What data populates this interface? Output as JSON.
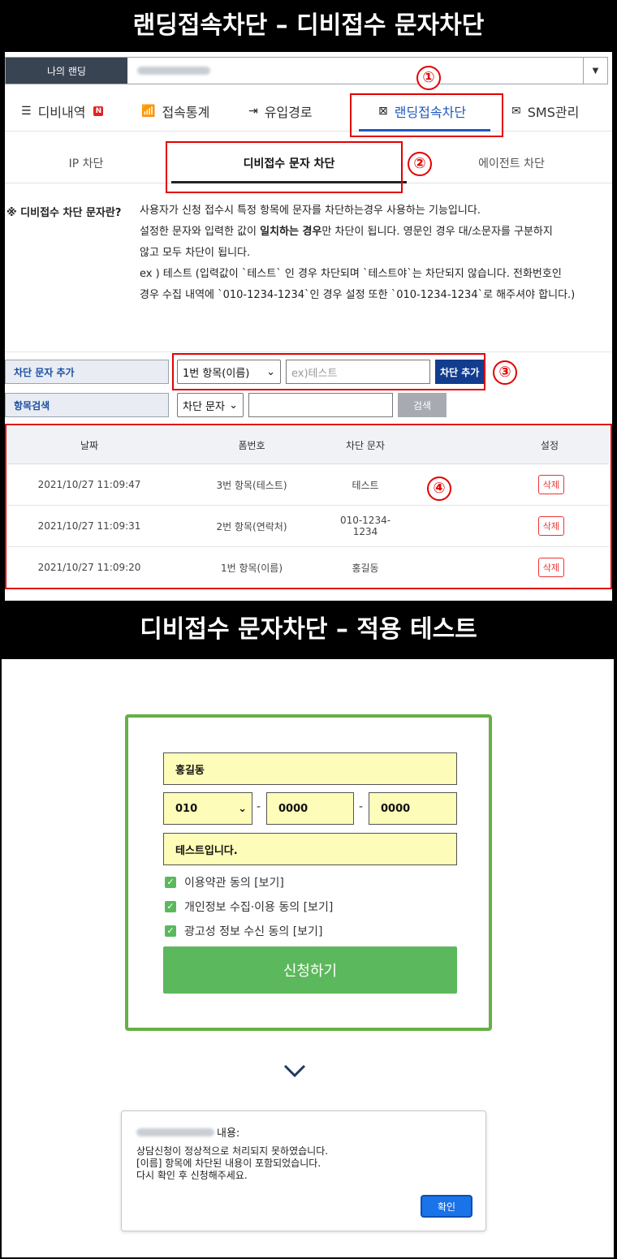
{
  "headers": {
    "top": "랜딩접속차단 – 디비접수 문자차단",
    "bottom": "디비접수 문자차단 – 적용 테스트"
  },
  "landing": {
    "label": "나의 랜딩"
  },
  "tabs": [
    {
      "label": "디비내역",
      "badge": "N"
    },
    {
      "label": "접속통계"
    },
    {
      "label": "유입경로"
    },
    {
      "label": "랜딩접속차단"
    },
    {
      "label": "SMS관리"
    }
  ],
  "subtabs": [
    {
      "label": "IP 차단"
    },
    {
      "label": "디비접수 문자 차단"
    },
    {
      "label": "에이전트 차단"
    }
  ],
  "description": {
    "title": "※ 디비접수 차단 문자란?",
    "line1": "사용자가 신청 접수시 특정 항목에 문자를 차단하는경우 사용하는 기능입니다.",
    "line2_pre": "설정한 문자와 입력한 값이 ",
    "line2_bold": "일치하는 경우",
    "line2_post": "만 차단이 됩니다. 영문인 경우 대/소문자를 구분하지",
    "line3": "않고 모두 차단이 됩니다.",
    "line4": "ex ) 테스트 (입력값이 `테스트` 인 경우 차단되며 `테스트야`는 차단되지 않습니다. 전화번호인",
    "line5": "경우 수집 내역에 `010-1234-1234`인 경우 설정 또한 `010-1234-1234`로 해주셔야 합니다.)"
  },
  "add_form": {
    "label": "차단 문자 추가",
    "select_value": "1번 항목(이름)",
    "placeholder": "ex)테스트",
    "button": "차단 추가"
  },
  "search_form": {
    "label": "항목검색",
    "select_value": "차단 문자",
    "button": "검색"
  },
  "table": {
    "headers": [
      "날짜",
      "폼번호",
      "차단 문자",
      "설정"
    ],
    "rows": [
      {
        "date": "2021/10/27 11:09:47",
        "form": "3번 항목(테스트)",
        "text": "테스트",
        "action": "삭제"
      },
      {
        "date": "2021/10/27 11:09:31",
        "form": "2번 항목(연락처)",
        "text": "010-1234-1234",
        "action": "삭제"
      },
      {
        "date": "2021/10/27 11:09:20",
        "form": "1번 항목(이름)",
        "text": "홍길동",
        "action": "삭제"
      }
    ]
  },
  "annotations": [
    "①",
    "②",
    "③",
    "④"
  ],
  "test_form": {
    "name": "홍길동",
    "phone1": "010",
    "phone2": "0000",
    "phone3": "0000",
    "dash": "-",
    "message": "테스트입니다.",
    "checks": [
      "이용약관 동의 [보기]",
      "개인정보 수집·이용 동의 [보기]",
      "광고성 정보 수신 동의 [보기]"
    ],
    "submit": "신청하기"
  },
  "alert": {
    "title_suffix": " 내용:",
    "line1": "상담신청이 정상적으로 처리되지 못하였습니다.",
    "line2": "[이름] 항목에 차단된 내용이 포함되었습니다.",
    "line3": "다시 확인 후 신청해주세요.",
    "ok": "확인"
  },
  "colors": {
    "accent_blue": "#1d57c0",
    "annotation_red": "#e30000",
    "form_green": "#5cb85c",
    "input_yellow": "#fdfcb8"
  }
}
